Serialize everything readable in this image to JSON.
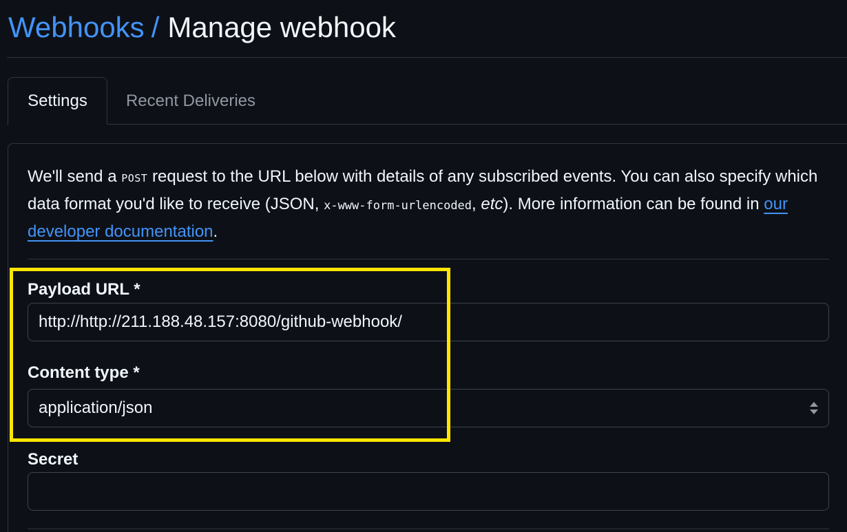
{
  "header": {
    "breadcrumb": "Webhooks",
    "separator": "/",
    "title": "Manage webhook"
  },
  "tabs": [
    {
      "label": "Settings",
      "active": true
    },
    {
      "label": "Recent Deliveries",
      "active": false
    }
  ],
  "intro": {
    "part1": "We'll send a ",
    "method": "POST",
    "part2": " request to the URL below with details of any subscribed events. You can also specify which data format you'd like to receive (JSON, ",
    "format_code": "x-www-form-urlencoded",
    "part3": ", ",
    "etc": "etc",
    "part4": "). More information can be found in ",
    "link": "our developer documentation",
    "part5": "."
  },
  "form": {
    "payload_url": {
      "label": "Payload URL *",
      "value": "http://http://211.188.48.157:8080/github-webhook/"
    },
    "content_type": {
      "label": "Content type *",
      "value": "application/json"
    },
    "secret": {
      "label": "Secret",
      "value": ""
    }
  },
  "colors": {
    "background": "#0d1117",
    "link": "#4493f8",
    "border": "#30363d",
    "highlight": "#ffe500"
  }
}
